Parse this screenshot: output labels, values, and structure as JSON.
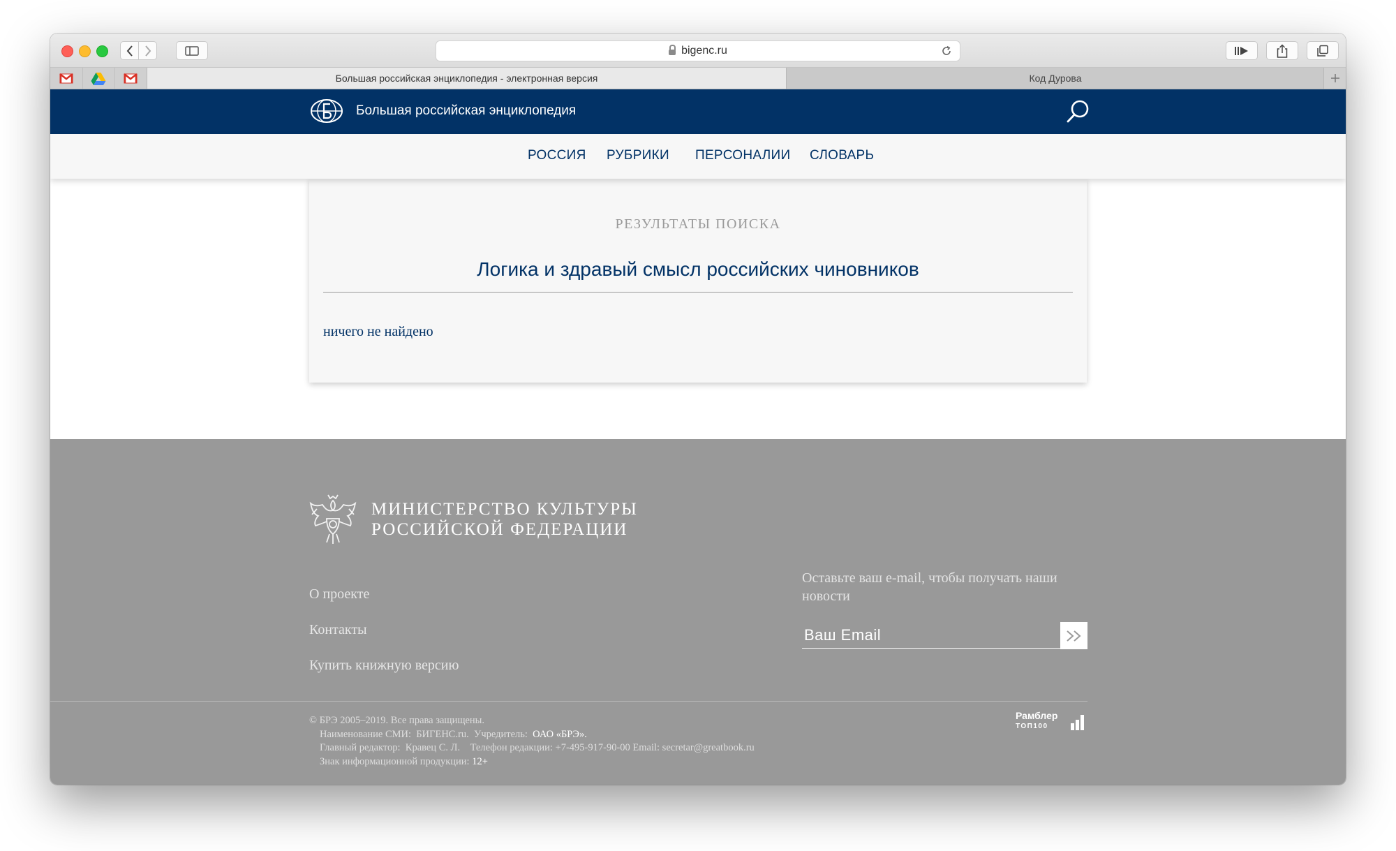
{
  "browser": {
    "url": "bigenc.ru",
    "tabs": [
      {
        "label": "Большая российская энциклопедия - электронная версия",
        "active": true
      },
      {
        "label": "Код Дурова",
        "active": false
      }
    ],
    "bookmarks": [
      "gmail-icon",
      "google-drive-icon",
      "gmail-icon"
    ]
  },
  "header": {
    "site_title": "Большая российская энциклопедия",
    "colors": {
      "brand": "#023266",
      "nav_bg": "#f7f7f7"
    }
  },
  "nav": {
    "items": [
      "РОССИЯ",
      "РУБРИКИ",
      "ПЕРСОНАЛИИ",
      "СЛОВАРЬ"
    ]
  },
  "results": {
    "heading": "РЕЗУЛЬТАТЫ ПОИСКА",
    "query": "Логика и здравый смысл российских чиновников",
    "empty_message": "ничего не найдено"
  },
  "footer": {
    "ministry_line1": "МИНИСТЕРСТВО КУЛЬТУРЫ",
    "ministry_line2": "РОССИЙСКОЙ ФЕДЕРАЦИИ",
    "links": [
      "О проекте",
      "Контакты",
      "Купить книжную версию"
    ],
    "subscribe_text": "Оставьте ваш e-mail, чтобы получать наши новости",
    "email_placeholder": "Ваш Email",
    "submit_label": ">>",
    "legal": {
      "copyright": "© БРЭ 2005–2019. Все права защищены.",
      "media_label": "Наименование СМИ:",
      "media_value": "БИГЕНС.ru.",
      "founder_label": "Учредитель:",
      "founder_value": "ОАО «БРЭ».",
      "editor_label": "Главный редактор:",
      "editor_value": "Кравец С. Л.",
      "contacts": "Телефон редакции: +7-495-917-90-00 Email: secretar@greatbook.ru",
      "age_label": "Знак информационной продукции:",
      "age_value": "12+"
    },
    "rambler_line1": "Рамблер",
    "rambler_line2": "ТОП100"
  }
}
